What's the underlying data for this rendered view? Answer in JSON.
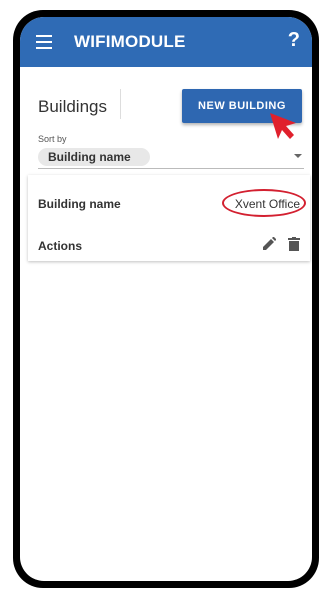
{
  "app_bar": {
    "title": "WIFIMODULE",
    "help_label": "?",
    "color": "#2f6bb5"
  },
  "page": {
    "title": "Buildings",
    "new_button_label": "NEW BUILDING"
  },
  "sort": {
    "label": "Sort by",
    "selected": "Building name"
  },
  "building": {
    "name_label": "Building name",
    "name_value": "Xvent Office",
    "actions_label": "Actions"
  },
  "icons": [
    "menu-icon",
    "help-icon",
    "pointer-arrow",
    "edit-icon",
    "delete-icon",
    "dropdown-arrow-icon"
  ],
  "annotation_color": "#d32030"
}
